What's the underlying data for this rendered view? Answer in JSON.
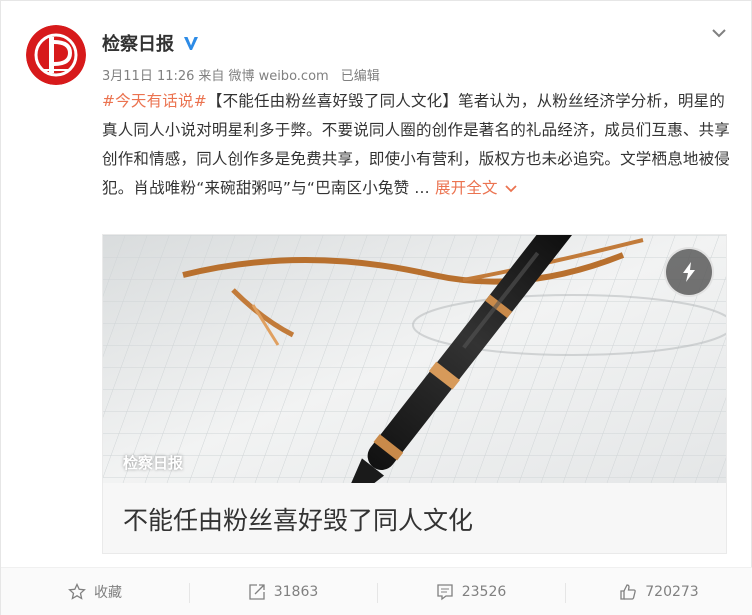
{
  "author": {
    "name": "检察日报",
    "avatar_icon": "procuratorate-logo-icon",
    "verified_icon": "verified-v-icon",
    "brand_color": "#d71a1b"
  },
  "post": {
    "date": "3月11日 11:26",
    "source_prefix": "来自",
    "source": "微博 weibo.com",
    "edited": "已编辑",
    "topic": "#今天有话说#",
    "text": "【不能任由粉丝喜好毁了同人文化】笔者认为，从粉丝经济学分析，明星的真人同人小说对明星利多于弊。不要说同人圈的创作是著名的礼品经济，成员们互惠、共享创作和情感，同人创作多是免费共享，即使小有营利，版权方也未必追究。文学栖息地被侵犯。肖战唯粉“来碗甜粥吗”与“巴南区小兔赞 ...",
    "expand_label": "展开全文",
    "accent_color": "#eb7350"
  },
  "media": {
    "source_label": "检察日报",
    "title": "不能任由粉丝喜好毁了同人文化",
    "play_icon": "lightning-icon"
  },
  "actions": {
    "favorite": {
      "label": "收藏",
      "icon": "star-icon"
    },
    "repost": {
      "count": "31863",
      "icon": "share-icon"
    },
    "comment": {
      "count": "23526",
      "icon": "comment-icon"
    },
    "like": {
      "count": "720273",
      "icon": "thumbs-up-icon"
    }
  }
}
